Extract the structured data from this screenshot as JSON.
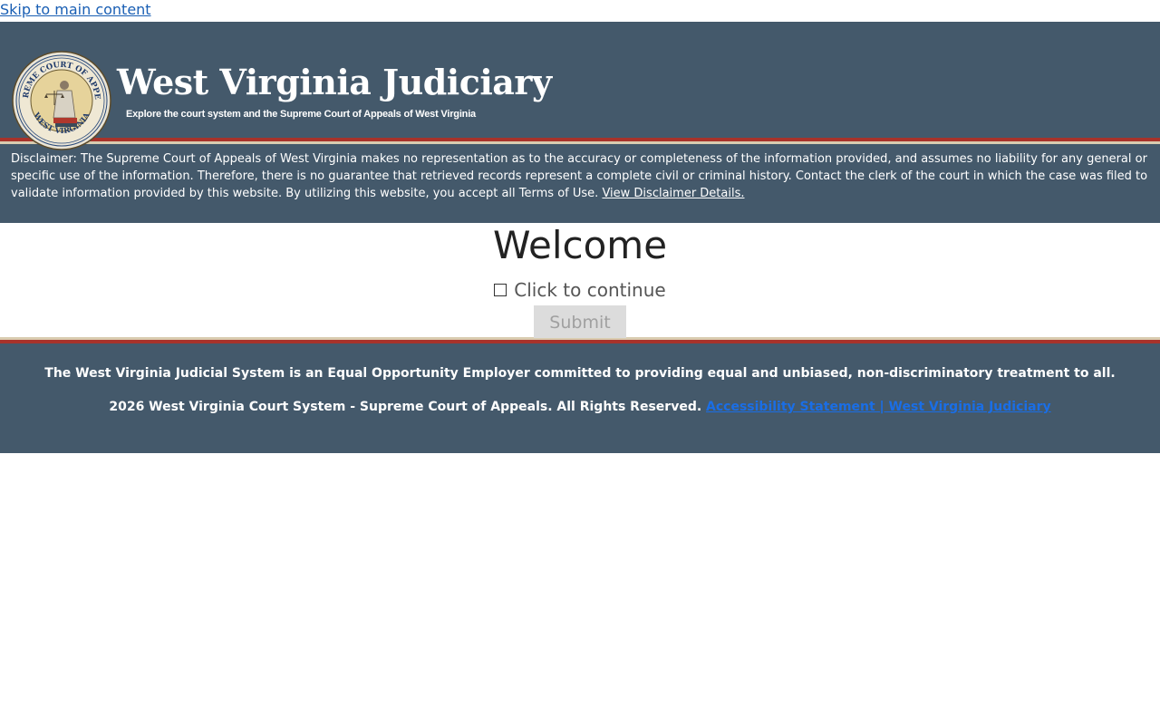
{
  "skip_link": "Skip to main content",
  "header": {
    "title": "West Virginia Judiciary",
    "subtitle": "Explore the court system and the Supreme Court of Appeals of West Virginia",
    "seal_text_top": "SUPREME COURT OF APPEALS",
    "seal_text_bottom": "WEST VIRGINIA"
  },
  "disclaimer": {
    "text": "Disclaimer: The Supreme Court of Appeals of West Virginia makes no representation as to the accuracy or completeness of the information provided, and assumes no liability for any general or specific use of the information. Therefore, there is no guarantee that retrieved records represent a complete civil or criminal history. Contact the clerk of the court in which the case was filed to validate information provided by this website. By utilizing this website, you accept all Terms of Use.",
    "link": "View Disclaimer Details."
  },
  "main": {
    "heading": "Welcome",
    "checkbox_label": "Click to continue",
    "submit_label": "Submit"
  },
  "footer": {
    "eeo": "The West Virginia Judicial System is an Equal Opportunity Employer committed to providing equal and unbiased, non-discriminatory treatment to all.",
    "copyright": "2026 West Virginia Court System - Supreme Court of Appeals. All Rights Reserved.",
    "accessibility_link": "Accessibility Statement | West Virginia Judiciary"
  },
  "colors": {
    "header_bg": "#44596b",
    "stripe_red": "#a8322a",
    "stripe_tan": "#d9ccb0",
    "link_blue": "#1a6ee6"
  }
}
